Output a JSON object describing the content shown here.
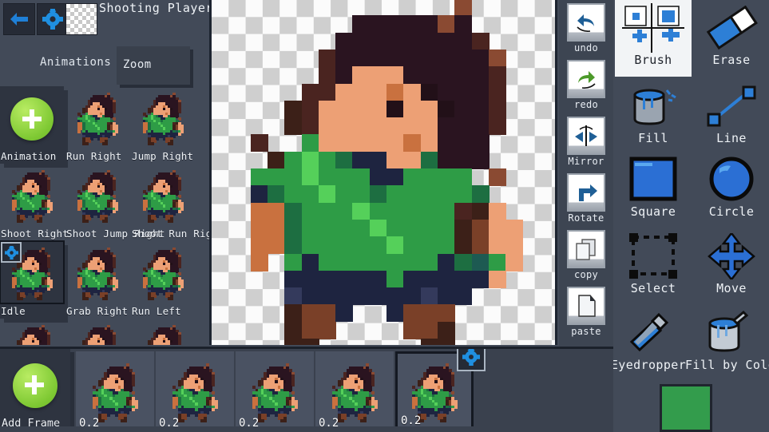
{
  "app": {
    "title": "Shooting Player",
    "background": "#424a58",
    "panel": "#2e3440",
    "accent": "#2d7fd6"
  },
  "topbar": {
    "back_icon": "back-arrow-icon",
    "settings_icon": "gear-icon",
    "transparent_swatch": "transparent-checker-swatch"
  },
  "tabs": {
    "animations_label": "Animations",
    "zoom_label": "Zoom"
  },
  "animations": {
    "add_label": "Animation",
    "items": [
      {
        "label": "Run Right",
        "selected": false
      },
      {
        "label": "Jump Right",
        "selected": false
      },
      {
        "label": "Shoot Right",
        "selected": false
      },
      {
        "label": "Shoot Jump Right",
        "selected": false
      },
      {
        "label": "Shoot Run Right",
        "selected": false
      },
      {
        "label": "Idle",
        "selected": true
      },
      {
        "label": "Grab Right",
        "selected": false
      },
      {
        "label": "Run Left",
        "selected": false
      }
    ]
  },
  "history_tools": [
    {
      "label": "undo",
      "icon": "undo-icon"
    },
    {
      "label": "redo",
      "icon": "redo-icon"
    },
    {
      "label": "Mirror",
      "icon": "mirror-icon"
    },
    {
      "label": "Rotate",
      "icon": "rotate-icon"
    },
    {
      "label": "copy",
      "icon": "copy-icon"
    },
    {
      "label": "paste",
      "icon": "paste-icon"
    }
  ],
  "draw_tools": [
    {
      "label": "Brush",
      "icon": "brush-icon",
      "active": true
    },
    {
      "label": "Erase",
      "icon": "eraser-icon",
      "active": false
    },
    {
      "label": "Fill",
      "icon": "paint-bucket-icon",
      "active": false
    },
    {
      "label": "Line",
      "icon": "line-icon",
      "active": false
    },
    {
      "label": "Square",
      "icon": "square-icon",
      "active": false
    },
    {
      "label": "Circle",
      "icon": "circle-icon",
      "active": false
    },
    {
      "label": "Select",
      "icon": "marquee-select-icon",
      "active": false
    },
    {
      "label": "Move",
      "icon": "move-arrows-icon",
      "active": false
    },
    {
      "label": "Eyedropper",
      "icon": "eyedropper-icon",
      "active": false
    },
    {
      "label": "Fill by Color",
      "icon": "fill-by-color-icon",
      "active": false
    }
  ],
  "color": {
    "current": "#339c4c",
    "name": "current-color-swatch"
  },
  "timeline": {
    "add_frame_label": "Add Frame",
    "frames": [
      {
        "duration": "0.2",
        "selected": false
      },
      {
        "duration": "0.2",
        "selected": false
      },
      {
        "duration": "0.2",
        "selected": false
      },
      {
        "duration": "0.2",
        "selected": false
      },
      {
        "duration": "0.2",
        "selected": true
      }
    ]
  },
  "canvas": {
    "checker_light": "#fbfbfb",
    "checker_dark": "#cfcfcf",
    "pixel_size": 21.3,
    "palette": {
      "hair_dark": "#2a1420",
      "hair_mid": "#4a2420",
      "hair_lt": "#8a4a32",
      "skin": "#eda075",
      "skin_sh": "#c9713f",
      "shirt": "#2e9c46",
      "shirt_lt": "#55d05a",
      "shirt_dk": "#1d6e41",
      "pants": "#1e2440",
      "pants_lt": "#343a5c",
      "boot": "#7a4028",
      "boot_dk": "#3c2018",
      "eye": "#221018",
      "teal": "#1d5a52"
    }
  }
}
